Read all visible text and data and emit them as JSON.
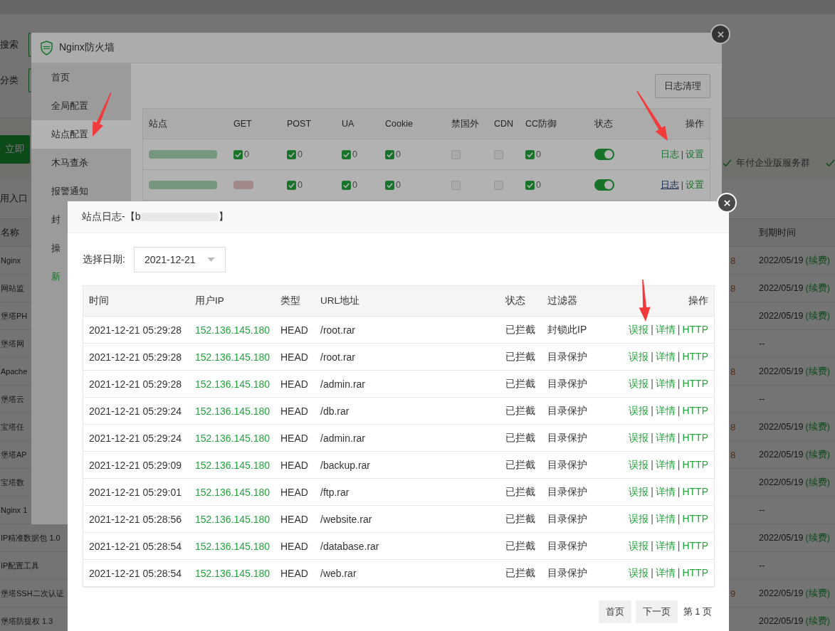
{
  "background_page": {
    "search_label": "搜索",
    "category_label": "分类",
    "buy_button": "立即",
    "service_label": "年付企业版服务群",
    "entry_label": "用入口",
    "columns": [
      "名称",
      "到期时间"
    ],
    "rows": [
      {
        "name": "Nginx",
        "price": "8",
        "expiry": "2022/05/19",
        "renew": "(续费)"
      },
      {
        "name": "网站监",
        "price": "8",
        "expiry": "2022/05/19",
        "renew": "(续费)"
      },
      {
        "name": "堡塔PH",
        "expiry": "2022/05/19",
        "renew": "(续费)"
      },
      {
        "name": "堡塔网",
        "expiry": "--"
      },
      {
        "name": "Apache",
        "price": "8",
        "expiry": "2022/05/19",
        "renew": "(续费)"
      },
      {
        "name": "堡塔云",
        "expiry": "--"
      },
      {
        "name": "宝塔任",
        "price": "8",
        "expiry": "2022/05/19",
        "renew": "(续费)"
      },
      {
        "name": "堡塔AP",
        "price": "8",
        "expiry": "2022/05/19",
        "renew": "(续费)"
      },
      {
        "name": "宝塔数",
        "expiry": "2022/05/19",
        "renew": "(续费)"
      },
      {
        "name": "Nginx 1",
        "expiry": "--"
      },
      {
        "name": "IP精准数据包 1.0",
        "expiry": "2022/05/19",
        "renew": "(续费)"
      },
      {
        "name": "IP配置工具",
        "expiry": "--"
      },
      {
        "name": "堡塔SSH二次认证",
        "price": "9",
        "expiry": "2022/05/19",
        "renew": "(续费)"
      },
      {
        "name": "堡塔防提权 1.3",
        "expiry": "2022/05/19",
        "renew": "(续费)"
      }
    ]
  },
  "firewall_window": {
    "title": "Nginx防火墙",
    "sidebar": [
      {
        "label": "首页",
        "kind": "nav",
        "selected": false
      },
      {
        "label": "全局配置",
        "kind": "nav",
        "selected": false
      },
      {
        "label": "站点配置",
        "kind": "nav",
        "selected": true
      },
      {
        "label": "木马查杀",
        "kind": "nav",
        "selected": false
      },
      {
        "label": "报警通知",
        "kind": "nav",
        "selected": false
      },
      {
        "label": "封",
        "kind": "nav",
        "selected": false
      },
      {
        "label": "操",
        "kind": "nav",
        "selected": false
      },
      {
        "label": "新",
        "kind": "promo",
        "selected": false
      }
    ],
    "clear_logs_button": "日志清理",
    "table": {
      "columns": [
        "站点",
        "GET",
        "POST",
        "UA",
        "Cookie",
        "禁国外",
        "CDN",
        "CC防御",
        "状态",
        "操作"
      ],
      "rows": [
        {
          "cells": [
            {
              "kind": "redacted"
            },
            {
              "kind": "checkbox",
              "checked": true,
              "count": "0"
            },
            {
              "kind": "checkbox",
              "checked": true,
              "count": "0"
            },
            {
              "kind": "checkbox",
              "checked": true,
              "count": "0"
            },
            {
              "kind": "checkbox",
              "checked": true,
              "count": "0"
            },
            {
              "kind": "checkbox",
              "checked": false
            },
            {
              "kind": "checkbox",
              "checked": false
            },
            {
              "kind": "checkbox",
              "checked": true,
              "count": "0"
            }
          ],
          "status_on": true,
          "actions": [
            {
              "kind": "link",
              "label": "日志",
              "hovered": false
            },
            {
              "kind": "sep",
              "label": "|"
            },
            {
              "kind": "link",
              "label": "设置",
              "hovered": false
            }
          ]
        },
        {
          "cells": [
            {
              "kind": "redacted"
            },
            {
              "kind": "redacted"
            },
            {
              "kind": "checkbox",
              "checked": true,
              "count": "0"
            },
            {
              "kind": "checkbox",
              "checked": true,
              "count": "0"
            },
            {
              "kind": "checkbox",
              "checked": true,
              "count": "0"
            },
            {
              "kind": "checkbox",
              "checked": false
            },
            {
              "kind": "checkbox",
              "checked": false
            },
            {
              "kind": "checkbox",
              "checked": true,
              "count": "0"
            }
          ],
          "status_on": true,
          "actions": [
            {
              "kind": "link",
              "label": "日志",
              "hovered": true
            },
            {
              "kind": "sep",
              "label": "|"
            },
            {
              "kind": "link",
              "label": "设置",
              "hovered": false
            }
          ]
        }
      ]
    }
  },
  "log_dialog": {
    "title_prefix": "站点日志-【b",
    "title_suffix": "】",
    "date_label": "选择日期:",
    "date_value": "2021-12-21",
    "table": {
      "columns": [
        "时间",
        "用户IP",
        "类型",
        "URL地址",
        "状态",
        "过滤器",
        "操作"
      ],
      "rows": [
        {
          "time": "2021-12-21 05:29:28",
          "ip": "152.136.145.180",
          "type": "HEAD",
          "url": "/root.rar",
          "status": "已拦截",
          "filter": "封锁此IP",
          "actions": [
            {
              "kind": "link",
              "label": "误报"
            },
            {
              "kind": "sep",
              "label": "|"
            },
            {
              "kind": "link",
              "label": "详情"
            },
            {
              "kind": "sep",
              "label": "|"
            },
            {
              "kind": "link",
              "label": "HTTP"
            }
          ]
        },
        {
          "time": "2021-12-21 05:29:28",
          "ip": "152.136.145.180",
          "type": "HEAD",
          "url": "/root.rar",
          "status": "已拦截",
          "filter": "目录保护",
          "actions": [
            {
              "kind": "link",
              "label": "误报"
            },
            {
              "kind": "sep",
              "label": "|"
            },
            {
              "kind": "link",
              "label": "详情"
            },
            {
              "kind": "sep",
              "label": "|"
            },
            {
              "kind": "link",
              "label": "HTTP"
            }
          ]
        },
        {
          "time": "2021-12-21 05:29:28",
          "ip": "152.136.145.180",
          "type": "HEAD",
          "url": "/admin.rar",
          "status": "已拦截",
          "filter": "目录保护",
          "actions": [
            {
              "kind": "link",
              "label": "误报"
            },
            {
              "kind": "sep",
              "label": "|"
            },
            {
              "kind": "link",
              "label": "详情"
            },
            {
              "kind": "sep",
              "label": "|"
            },
            {
              "kind": "link",
              "label": "HTTP"
            }
          ]
        },
        {
          "time": "2021-12-21 05:29:24",
          "ip": "152.136.145.180",
          "type": "HEAD",
          "url": "/db.rar",
          "status": "已拦截",
          "filter": "目录保护",
          "actions": [
            {
              "kind": "link",
              "label": "误报"
            },
            {
              "kind": "sep",
              "label": "|"
            },
            {
              "kind": "link",
              "label": "详情"
            },
            {
              "kind": "sep",
              "label": "|"
            },
            {
              "kind": "link",
              "label": "HTTP"
            }
          ]
        },
        {
          "time": "2021-12-21 05:29:24",
          "ip": "152.136.145.180",
          "type": "HEAD",
          "url": "/admin.rar",
          "status": "已拦截",
          "filter": "目录保护",
          "actions": [
            {
              "kind": "link",
              "label": "误报"
            },
            {
              "kind": "sep",
              "label": "|"
            },
            {
              "kind": "link",
              "label": "详情"
            },
            {
              "kind": "sep",
              "label": "|"
            },
            {
              "kind": "link",
              "label": "HTTP"
            }
          ]
        },
        {
          "time": "2021-12-21 05:29:09",
          "ip": "152.136.145.180",
          "type": "HEAD",
          "url": "/backup.rar",
          "status": "已拦截",
          "filter": "目录保护",
          "actions": [
            {
              "kind": "link",
              "label": "误报"
            },
            {
              "kind": "sep",
              "label": "|"
            },
            {
              "kind": "link",
              "label": "详情"
            },
            {
              "kind": "sep",
              "label": "|"
            },
            {
              "kind": "link",
              "label": "HTTP"
            }
          ]
        },
        {
          "time": "2021-12-21 05:29:01",
          "ip": "152.136.145.180",
          "type": "HEAD",
          "url": "/ftp.rar",
          "status": "已拦截",
          "filter": "目录保护",
          "actions": [
            {
              "kind": "link",
              "label": "误报"
            },
            {
              "kind": "sep",
              "label": "|"
            },
            {
              "kind": "link",
              "label": "详情"
            },
            {
              "kind": "sep",
              "label": "|"
            },
            {
              "kind": "link",
              "label": "HTTP"
            }
          ]
        },
        {
          "time": "2021-12-21 05:28:56",
          "ip": "152.136.145.180",
          "type": "HEAD",
          "url": "/website.rar",
          "status": "已拦截",
          "filter": "目录保护",
          "actions": [
            {
              "kind": "link",
              "label": "误报"
            },
            {
              "kind": "sep",
              "label": "|"
            },
            {
              "kind": "link",
              "label": "详情"
            },
            {
              "kind": "sep",
              "label": "|"
            },
            {
              "kind": "link",
              "label": "HTTP"
            }
          ]
        },
        {
          "time": "2021-12-21 05:28:54",
          "ip": "152.136.145.180",
          "type": "HEAD",
          "url": "/database.rar",
          "status": "已拦截",
          "filter": "目录保护",
          "actions": [
            {
              "kind": "link",
              "label": "误报"
            },
            {
              "kind": "sep",
              "label": "|"
            },
            {
              "kind": "link",
              "label": "详情"
            },
            {
              "kind": "sep",
              "label": "|"
            },
            {
              "kind": "link",
              "label": "HTTP"
            }
          ]
        },
        {
          "time": "2021-12-21 05:28:54",
          "ip": "152.136.145.180",
          "type": "HEAD",
          "url": "/web.rar",
          "status": "已拦截",
          "filter": "目录保护",
          "actions": [
            {
              "kind": "link",
              "label": "误报"
            },
            {
              "kind": "sep",
              "label": "|"
            },
            {
              "kind": "link",
              "label": "详情"
            },
            {
              "kind": "sep",
              "label": "|"
            },
            {
              "kind": "link",
              "label": "HTTP"
            }
          ]
        }
      ]
    },
    "pagination": [
      {
        "kind": "button",
        "label": "首页"
      },
      {
        "kind": "button",
        "label": "下一页"
      },
      {
        "kind": "text",
        "label": "第 1 页"
      }
    ]
  }
}
